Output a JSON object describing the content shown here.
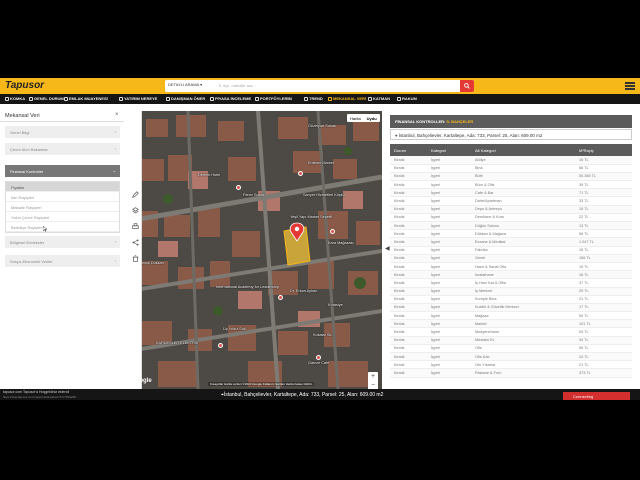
{
  "app": {
    "brand": "Tapusor"
  },
  "search": {
    "category": "DETAYLI ARAMA ▾",
    "placeholder": "İl, ilçe, mahalle ara..."
  },
  "nav": {
    "items": [
      {
        "label": "KOMKA",
        "icon": "home-icon"
      },
      {
        "label": "GENEL DURUM",
        "icon": "pin-icon"
      },
      {
        "label": "EMLAK MUAYENESİ",
        "icon": "house-icon"
      },
      {
        "label": "YATIRIM NEREYE",
        "icon": "chart-icon"
      },
      {
        "label": "DANIŞMAN ÖNER",
        "icon": "user-icon"
      },
      {
        "label": "PİYASA İNCELEME",
        "icon": "search-icon"
      },
      {
        "label": "PORTFÖYLERİM",
        "icon": "folder-icon"
      },
      {
        "label": "TREND",
        "icon": "trend-icon"
      },
      {
        "label": "MEKANSAL VERİ",
        "icon": "map-icon"
      },
      {
        "label": "KATMAN",
        "icon": "layers-icon"
      },
      {
        "label": "RAKUM",
        "icon": "grid-icon"
      }
    ],
    "active": "MEKANSAL VERİ"
  },
  "left_panel": {
    "title": "Mekansal Veri",
    "close": "×",
    "sections": [
      {
        "label": "Genel Bilgi",
        "chevron": "›"
      },
      {
        "label": "Çevre Alım Rakamlar",
        "chevron": "›"
      },
      {
        "label": "Finansal Kontroller",
        "chevron": "⌄"
      },
      {
        "label": "Bölgesel Endeksler",
        "chevron": "›"
      },
      {
        "label": "Sosyo-Ekonomik Veriler",
        "chevron": "›"
      }
    ],
    "sub_items": [
      {
        "label": "Fiyatlar"
      },
      {
        "label": "İlan Rayiçleri"
      },
      {
        "label": "Mahalle Rayiçleri"
      },
      {
        "label": "Yakın Çevre Rayiçleri"
      },
      {
        "label": "Belediye Rayiçleri"
      }
    ]
  },
  "map": {
    "type_options": [
      "Harita",
      "Uydu"
    ],
    "type_selected": "Uydu",
    "zoom_in": "+",
    "zoom_out": "−",
    "google": "Google",
    "attribution": "Kısayollar  Harita verileri ©2023 Google  Kullanım Şartları  Harita hatası bildirin",
    "labels": [
      "Sarıyer Hizmetleri Köşkü",
      "Güzelyurt Sokak",
      "Yeşil Yapı Market Sepetfi",
      "Dernek Hotel",
      "Erdemir Market",
      "Kara Mağazası",
      "Karışık Dükkan",
      "International Academy for Leadership",
      "Dr. Erkan Ayhan",
      "KARDEŞLER ELEKTRİK",
      "Kırtasiye",
      "Gamze Cafe",
      "Üç Yıldız Sok.",
      "Fener Sokak",
      "Kokalar Sk."
    ]
  },
  "right_panel": {
    "header_title": "FİNANSAL KONTROLLER",
    "header_sub": "İL BAHÇELER",
    "address": "İstanbul, Bahçelievler, Kartaltepe, Ada: 733, Parsel: 25, Alan: 609.00 m2",
    "columns": [
      "Durum",
      "Kategori",
      "Alt Kategori",
      "M²Rayiç"
    ],
    "rows": [
      [
        "Kiralık",
        "İşyeri",
        "Atölye",
        "15 TL"
      ],
      [
        "Kiralık",
        "İşyeri",
        "Bina",
        "66 TL"
      ],
      [
        "Kiralık",
        "İşyeri",
        "Büfe",
        "50.385 TL"
      ],
      [
        "Kiralık",
        "İşyeri",
        "Büro & Ofis",
        "39 TL"
      ],
      [
        "Kiralık",
        "İşyeri",
        "Cafe & Bar",
        "71 TL"
      ],
      [
        "Kiralık",
        "İşyeri",
        "Daire/Apartman",
        "33 TL"
      ],
      [
        "Kiralık",
        "İşyeri",
        "Depo & Antrepo",
        "15 TL"
      ],
      [
        "Kiralık",
        "İşyeri",
        "Dershane & Kurs",
        "22 TL"
      ],
      [
        "Kiralık",
        "İşyeri",
        "Düğün Salonu",
        "13 TL"
      ],
      [
        "Kiralık",
        "İşyeri",
        "Dükkan & Mağaza",
        "56 TL"
      ],
      [
        "Kiralık",
        "İşyeri",
        "Eczane & Medikal",
        "1.047 TL"
      ],
      [
        "Kiralık",
        "İşyeri",
        "Fabrika",
        "16 TL"
      ],
      [
        "Kiralık",
        "İşyeri",
        "Genel",
        "156 TL"
      ],
      [
        "Kiralık",
        "İşyeri",
        "Hazır & Sanal Ofis",
        "19 TL"
      ],
      [
        "Kiralık",
        "İşyeri",
        "İmalathane",
        "16 TL"
      ],
      [
        "Kiralık",
        "İşyeri",
        "İş Hanı Kat & Ofisi",
        "37 TL"
      ],
      [
        "Kiralık",
        "İşyeri",
        "İş Merkezi",
        "29 TL"
      ],
      [
        "Kiralık",
        "İşyeri",
        "Komple Bina",
        "21 TL"
      ],
      [
        "Kiralık",
        "İşyeri",
        "Kuaför & Güzellik Merkezi",
        "17 TL"
      ],
      [
        "Kiralık",
        "İşyeri",
        "Mağaza",
        "50 TL"
      ],
      [
        "Kiralık",
        "İşyeri",
        "Market",
        "101 TL"
      ],
      [
        "Kiralık",
        "İşyeri",
        "Muayenehane",
        "53 TL"
      ],
      [
        "Kiralık",
        "İşyeri",
        "Müstakil Ev",
        "34 TL"
      ],
      [
        "Kiralık",
        "İşyeri",
        "Ofis",
        "59 TL"
      ],
      [
        "Kiralık",
        "İşyeri",
        "Ofis Katı",
        "24 TL"
      ],
      [
        "Kiralık",
        "İşyeri",
        "Oto Yıkama",
        "21 TL"
      ],
      [
        "Kiralık",
        "İşyeri",
        "Pastane & Fırın",
        "373 TL"
      ]
    ]
  },
  "status_bar": {
    "address": "İstanbul, Bahçelievler, Kartaltepe, Ada: 733, Parsel: 25, Alan: 609.00 m2",
    "connect": "Connecting",
    "left_line1": "tapusor.com   Tapusor'a Hoşgeldiniz eklendi",
    "left_line2": "https://www.tapusor.com/maps/mekansalveri/?id=7394af0b..."
  },
  "colors": {
    "brand": "#f6b818",
    "nav_bg": "#151515",
    "accent_red": "#e53935",
    "table_header": "#5b5b5b"
  }
}
